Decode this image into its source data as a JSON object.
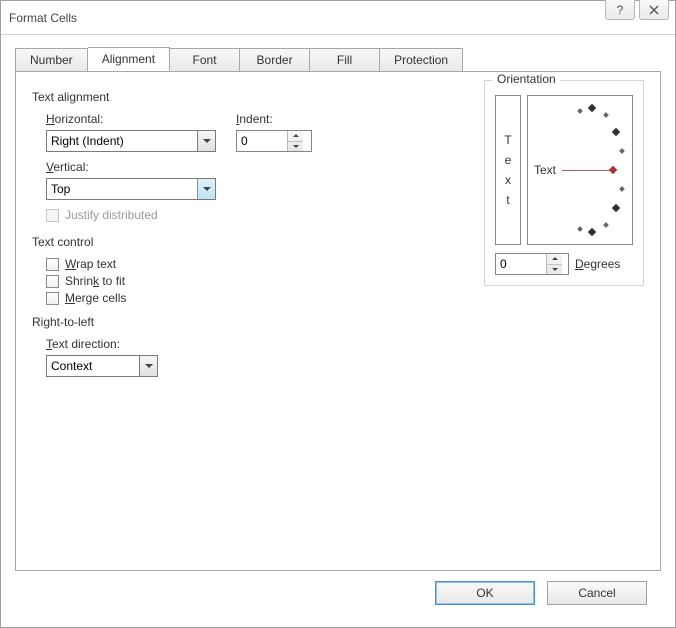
{
  "window": {
    "title": "Format Cells"
  },
  "tabs": [
    {
      "label": "Number"
    },
    {
      "label": "Alignment"
    },
    {
      "label": "Font"
    },
    {
      "label": "Border"
    },
    {
      "label": "Fill"
    },
    {
      "label": "Protection"
    }
  ],
  "alignment": {
    "text_alignment_label": "Text alignment",
    "horizontal_label_pre": "H",
    "horizontal_label_post": "orizontal:",
    "horizontal_value": "Right (Indent)",
    "indent_label_pre": "I",
    "indent_label_post": "ndent:",
    "indent_value": "0",
    "vertical_label_pre": "V",
    "vertical_label_post": "ertical:",
    "vertical_value": "Top",
    "justify_distributed_label": "Justify distributed"
  },
  "text_control": {
    "section_label": "Text control",
    "wrap_pre": "W",
    "wrap_post": "rap text",
    "shrink_label": "Shrin",
    "shrink_k": "k",
    "shrink_post": " to fit",
    "merge_pre": "M",
    "merge_post": "erge cells"
  },
  "rtl": {
    "section_label": "Right-to-left",
    "text_direction_pre": "T",
    "text_direction_post": "ext direction:",
    "text_direction_value": "Context"
  },
  "orientation": {
    "legend": "Orientation",
    "vtext": [
      "T",
      "e",
      "x",
      "t"
    ],
    "dial_label": "Text",
    "degrees_value": "0",
    "degrees_label_pre": "D",
    "degrees_label_post": "egrees"
  },
  "buttons": {
    "ok": "OK",
    "cancel": "Cancel"
  }
}
